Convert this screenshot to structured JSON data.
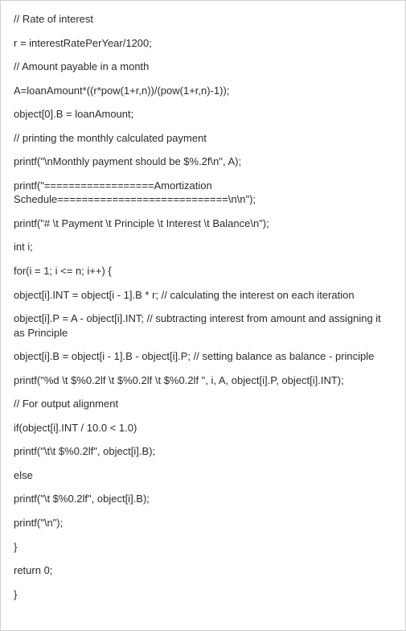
{
  "lines": [
    "// Rate of interest",
    "r = interestRatePerYear/1200;",
    "// Amount payable in a month",
    "A=loanAmount*((r*pow(1+r,n))/(pow(1+r,n)-1));",
    "object[0].B = loanAmount;",
    "// printing the monthly calculated payment",
    "printf(\"\\nMonthly payment should be $%.2f\\n\", A);",
    "printf(\"==================Amortization Schedule============================\\n\\n\");",
    "printf(\"# \\t Payment \\t Principle \\t Interest \\t Balance\\n\");",
    "int i;",
    "for(i = 1; i <= n; i++) {",
    "object[i].INT = object[i - 1].B * r; // calculating the interest on each iteration",
    "object[i].P = A - object[i].INT; // subtracting interest from amount and assigning it as Principle",
    "object[i].B = object[i - 1].B - object[i].P; // setting balance as balance - principle",
    "printf(\"%d \\t $%0.2lf \\t $%0.2lf \\t $%0.2lf \", i, A, object[i].P, object[i].INT);",
    "// For output alignment",
    "if(object[i].INT / 10.0 < 1.0)",
    "printf(\"\\t\\t $%0.2lf\", object[i].B);",
    "else",
    "printf(\"\\t $%0.2lf\", object[i].B);",
    "printf(\"\\n\");",
    "}",
    "return 0;",
    "}"
  ]
}
